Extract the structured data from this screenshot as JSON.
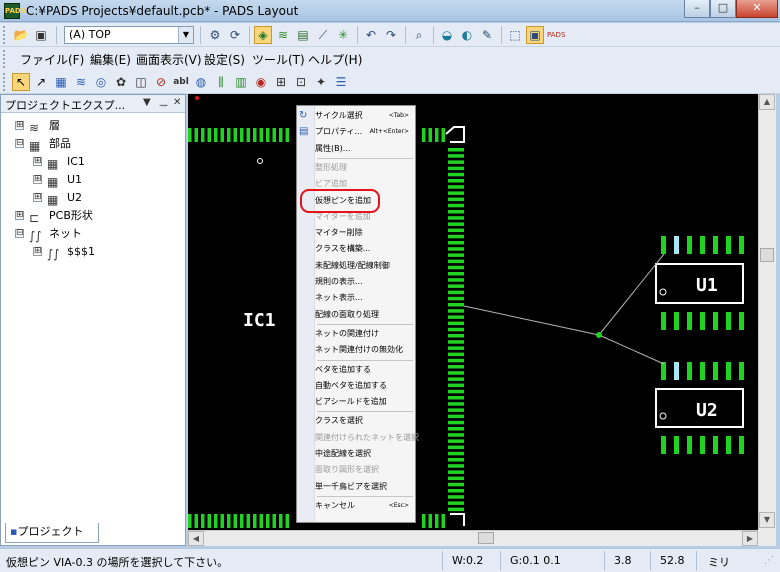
{
  "window": {
    "title": "C:¥PADS Projects¥default.pcb* - PADS Layout",
    "app_badge": "PADS",
    "minimize": "–",
    "maximize": "□",
    "close": "✕"
  },
  "toolbar": {
    "layer_value": "(A) TOP"
  },
  "menu": {
    "items": [
      "ファイル(F)",
      "編集(E)",
      "画面表示(V)",
      "設定(S)",
      "ツール(T)",
      "ヘルプ(H)"
    ]
  },
  "panel": {
    "title": "プロジェクトエクスプ...",
    "controls": [
      "▼",
      "ᅲ",
      "✕"
    ],
    "tab": "プロジェクト",
    "tree": [
      {
        "exp": "⊞",
        "icon": "layers-icon",
        "glyph": "≋",
        "label": "層",
        "level": 0
      },
      {
        "exp": "⊟",
        "icon": "component-icon",
        "glyph": "▦",
        "label": "部品",
        "level": 0
      },
      {
        "exp": "⊞",
        "icon": "component-icon",
        "glyph": "▦",
        "label": "IC1",
        "level": 1
      },
      {
        "exp": "⊞",
        "icon": "component-icon",
        "glyph": "▦",
        "label": "U1",
        "level": 1
      },
      {
        "exp": "⊞",
        "icon": "component-icon",
        "glyph": "▦",
        "label": "U2",
        "level": 1
      },
      {
        "exp": "⊞",
        "icon": "pcb-outline-icon",
        "glyph": "⊏",
        "label": "PCB形状",
        "level": 0
      },
      {
        "exp": "⊟",
        "icon": "net-icon",
        "glyph": "∫∫",
        "label": "ネット",
        "level": 0
      },
      {
        "exp": "⊞",
        "icon": "net-icon",
        "glyph": "∫∫",
        "label": "$$$1",
        "level": 1
      }
    ]
  },
  "canvas": {
    "labels": {
      "ic1": "IC1",
      "u1": "U1",
      "u2": "U2"
    }
  },
  "context_menu": {
    "items": [
      {
        "label": "サイクル選択",
        "shortcut": "<Tab>",
        "disabled": false,
        "icon": "cycle-select-icon",
        "glyph": "↻"
      },
      {
        "label": "プロパティ...",
        "shortcut": "Alt+<Enter>",
        "disabled": false,
        "icon": "properties-icon",
        "glyph": "▤"
      },
      {
        "label": "属性(B)...",
        "shortcut": "",
        "disabled": false,
        "sep_after": true
      },
      {
        "label": "整形処理",
        "shortcut": "",
        "disabled": true
      },
      {
        "label": "ビア追加",
        "shortcut": "",
        "disabled": true
      },
      {
        "label": "仮想ピンを追加",
        "shortcut": "",
        "disabled": false
      },
      {
        "label": "マイターを追加",
        "shortcut": "",
        "disabled": true
      },
      {
        "label": "マイター削除",
        "shortcut": "",
        "disabled": false
      },
      {
        "label": "クラスを構築...",
        "shortcut": "",
        "disabled": false
      },
      {
        "label": "未配線処理/配線制御",
        "shortcut": "",
        "disabled": false
      },
      {
        "label": "規則の表示...",
        "shortcut": "",
        "disabled": false
      },
      {
        "label": "ネット表示...",
        "shortcut": "",
        "disabled": false
      },
      {
        "label": "配線の面取り処理",
        "shortcut": "",
        "disabled": false,
        "sep_after": true
      },
      {
        "label": "ネットの関連付け",
        "shortcut": "",
        "disabled": false
      },
      {
        "label": "ネット関連付けの無効化",
        "shortcut": "",
        "disabled": false,
        "sep_after": true
      },
      {
        "label": "ベタを追加する",
        "shortcut": "",
        "disabled": false
      },
      {
        "label": "自動ベタを追加する",
        "shortcut": "",
        "disabled": false
      },
      {
        "label": "ビアシールドを追加",
        "shortcut": "",
        "disabled": false,
        "sep_after": true
      },
      {
        "label": "クラスを選択",
        "shortcut": "",
        "disabled": false
      },
      {
        "label": "関連付けられたネットを選択",
        "shortcut": "",
        "disabled": true
      },
      {
        "label": "中途配線を選択",
        "shortcut": "",
        "disabled": false
      },
      {
        "label": "面取り図形を選択",
        "shortcut": "",
        "disabled": true
      },
      {
        "label": "単一千鳥ビアを選択",
        "shortcut": "",
        "disabled": false,
        "sep_after": true
      },
      {
        "label": "キャンセル",
        "shortcut": "<Esc>",
        "disabled": false
      }
    ]
  },
  "status": {
    "message": "仮想ピン VIA-0.3 の場所を選択して下さい。",
    "width": "W:0.2",
    "grid": "G:0.1 0.1",
    "x": "3.8",
    "y": "52.8",
    "units": "ミリ"
  },
  "colors": {
    "pad": "#21d321",
    "pad_highlight": "#a6e6f7",
    "ratsnest": "#b5b5b5",
    "outline": "#ffffff",
    "canvas": "#000000",
    "highlight_circle": "#e3141b"
  }
}
